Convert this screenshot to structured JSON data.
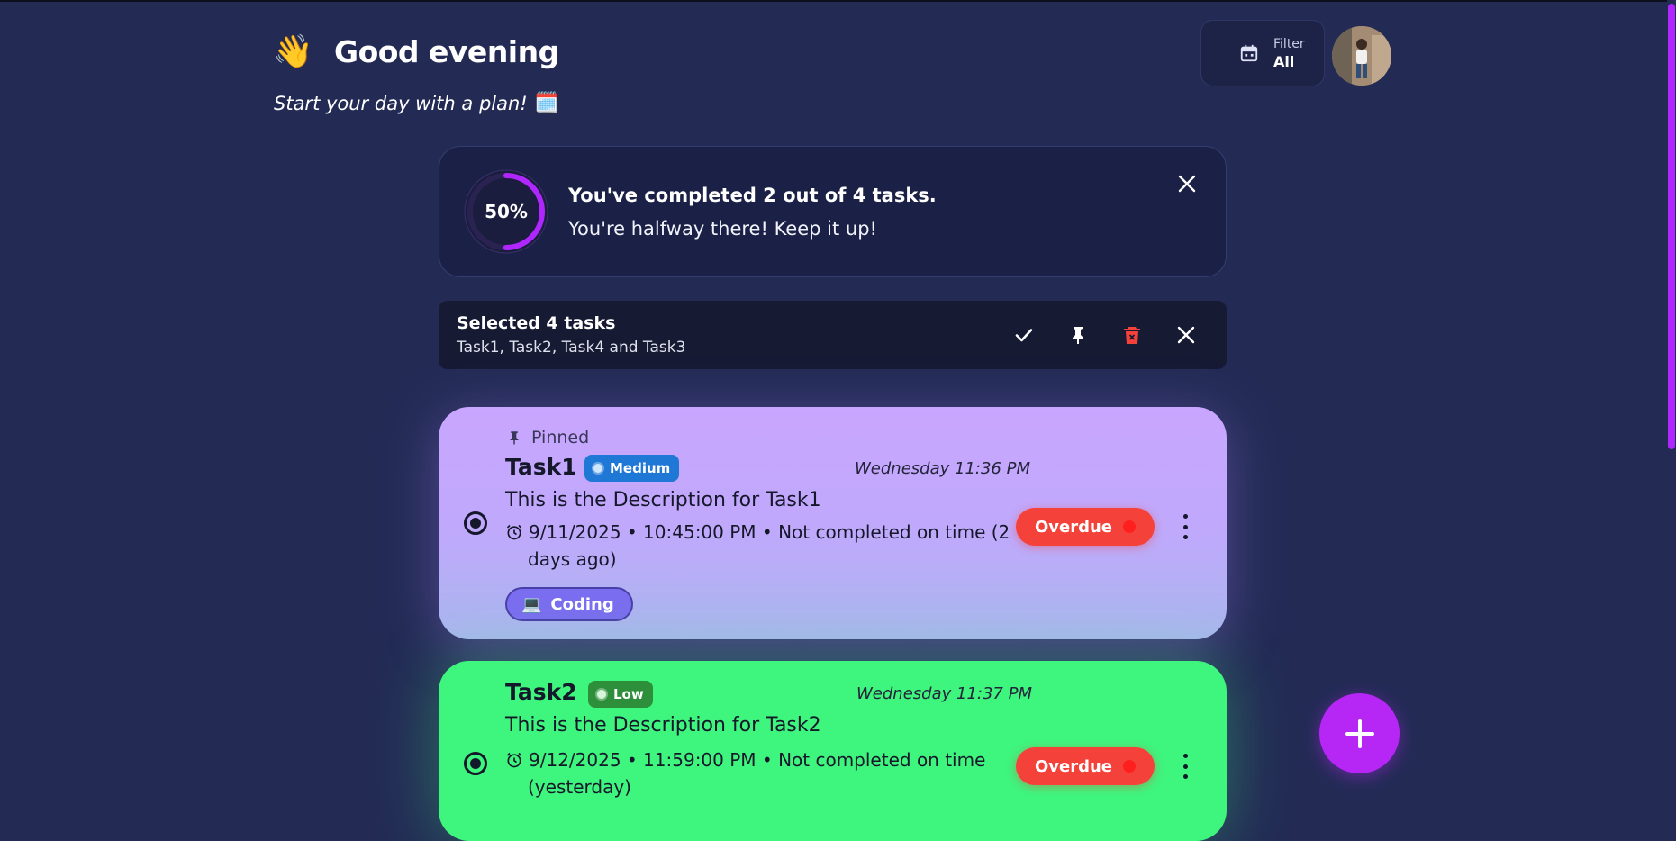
{
  "header": {
    "wave_emoji": "👋",
    "greeting": "Good evening",
    "subtitle": "Start your day with a plan!",
    "subtitle_emoji": "🗓️"
  },
  "filter": {
    "label": "Filter",
    "value": "All",
    "icon": "calendar-icon"
  },
  "avatar": {
    "icon": "user-avatar"
  },
  "progress": {
    "percent_text": "50%",
    "percent": 0.5,
    "title": "You've completed 2 out of 4 tasks.",
    "message": "You're halfway there! Keep it up!",
    "ring_color": "#b026ff"
  },
  "selection": {
    "title": "Selected 4 tasks",
    "names": "Task1, Task2, Task4 and Task3",
    "actions": [
      "check-icon",
      "pin-icon",
      "delete-icon",
      "close-icon"
    ]
  },
  "tasks": [
    {
      "pinned_label": "Pinned",
      "name": "Task1",
      "priority": "Medium",
      "priority_color": "#1f78d6",
      "date": "Wednesday 11:36 PM",
      "description": "This is the Description for Task1",
      "due_line1": "9/11/2025 • 10:45:00 PM • Not completed on time (2",
      "due_line2": "days ago)",
      "status": "Overdue",
      "category": "Coding",
      "category_emoji": "💻",
      "card_color": "#c9a6ff"
    },
    {
      "name": "Task2",
      "priority": "Low",
      "priority_color": "#2e8f3a",
      "date": "Wednesday 11:37 PM",
      "description": "This is the Description for Task2",
      "due_line1": "9/12/2025 • 11:59:00 PM • Not completed on time",
      "due_line2": "(yesterday)",
      "status": "Overdue",
      "card_color": "#3ef57d"
    }
  ],
  "fab": {
    "icon": "plus-icon"
  },
  "colors": {
    "background": "#232b55",
    "accent": "#b626f5",
    "overdue": "#f4423b"
  }
}
